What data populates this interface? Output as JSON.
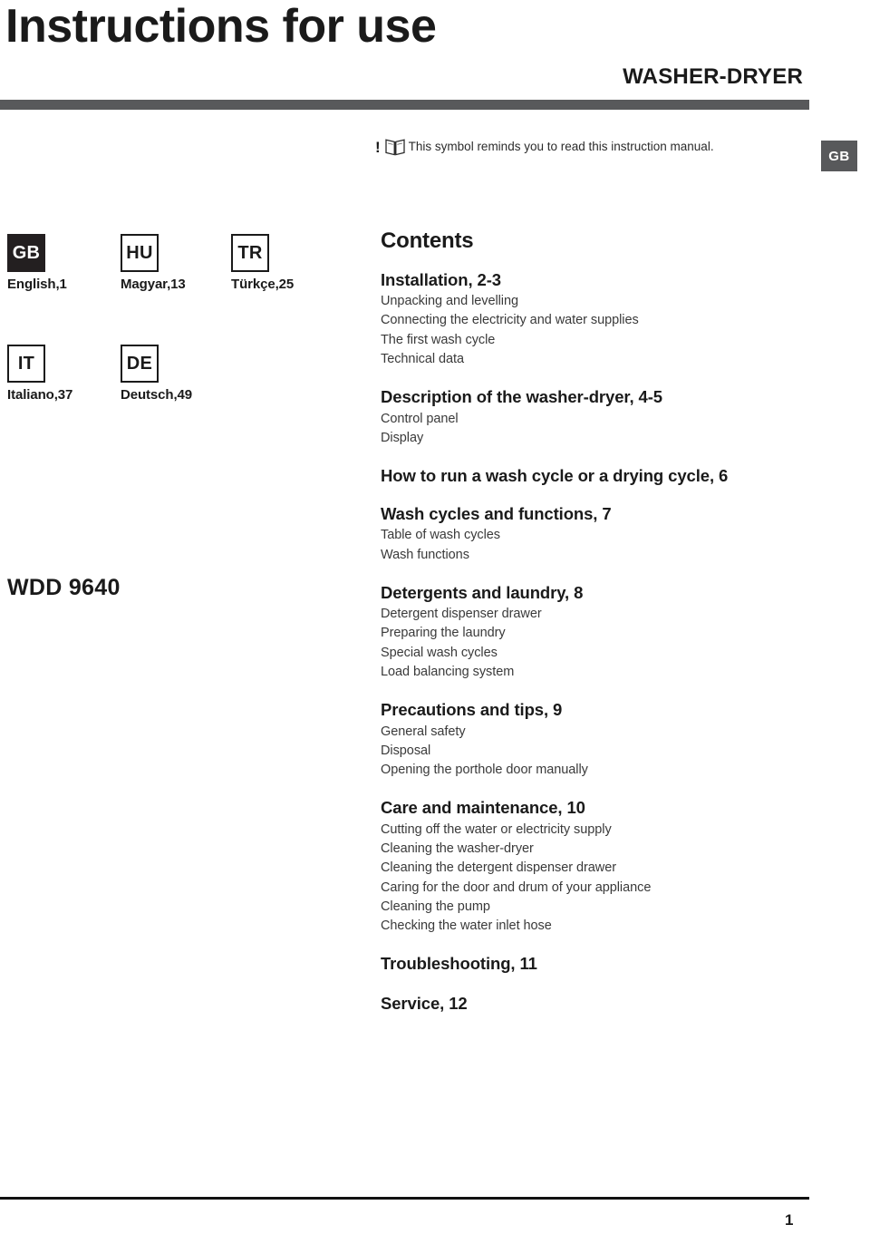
{
  "header": {
    "title": "Instructions for use",
    "product_type": "WASHER-DRYER",
    "symbol_bang": "!",
    "symbol_icon": "open-book-icon",
    "symbol_note": "This symbol reminds you to read this instruction manual.",
    "language_badge": "GB",
    "rule_color": "#58595B"
  },
  "languages": [
    {
      "code": "GB",
      "caption": "English,1",
      "selected": true
    },
    {
      "code": "HU",
      "caption": "Magyar,13",
      "selected": false
    },
    {
      "code": "TR",
      "caption": "Türkçe,25",
      "selected": false
    },
    {
      "code": "IT",
      "caption": "Italiano,37",
      "selected": false
    },
    {
      "code": "DE",
      "caption": "Deutsch,49",
      "selected": false
    }
  ],
  "model": {
    "name": "WDD 9640"
  },
  "contents": {
    "title": "Contents",
    "sections": [
      {
        "heading": "Installation, 2-3",
        "items": [
          "Unpacking and levelling",
          "Connecting the electricity and water supplies",
          "The first wash cycle",
          "Technical data"
        ]
      },
      {
        "heading": "Description of the washer-dryer, 4-5",
        "items": [
          "Control panel",
          "Display"
        ]
      },
      {
        "heading": "How to run a wash cycle or a drying cycle, 6",
        "items": []
      },
      {
        "heading": "Wash cycles and functions, 7",
        "items": [
          "Table of wash cycles",
          "Wash functions"
        ]
      },
      {
        "heading": "Detergents and laundry, 8",
        "items": [
          "Detergent dispenser drawer",
          "Preparing the laundry",
          "Special wash cycles",
          "Load balancing system"
        ]
      },
      {
        "heading": "Precautions and tips, 9",
        "items": [
          "General safety",
          "Disposal",
          "Opening the porthole door manually"
        ]
      },
      {
        "heading": "Care and maintenance, 10",
        "items": [
          "Cutting off the water or electricity supply",
          "Cleaning the washer-dryer",
          "Cleaning the detergent dispenser drawer",
          "Caring for the door and drum of your appliance",
          "Cleaning the pump",
          "Checking the water inlet hose"
        ]
      },
      {
        "heading": "Troubleshooting, 11",
        "items": []
      },
      {
        "heading": "Service, 12",
        "items": []
      }
    ]
  },
  "footer": {
    "page_number": "1"
  }
}
